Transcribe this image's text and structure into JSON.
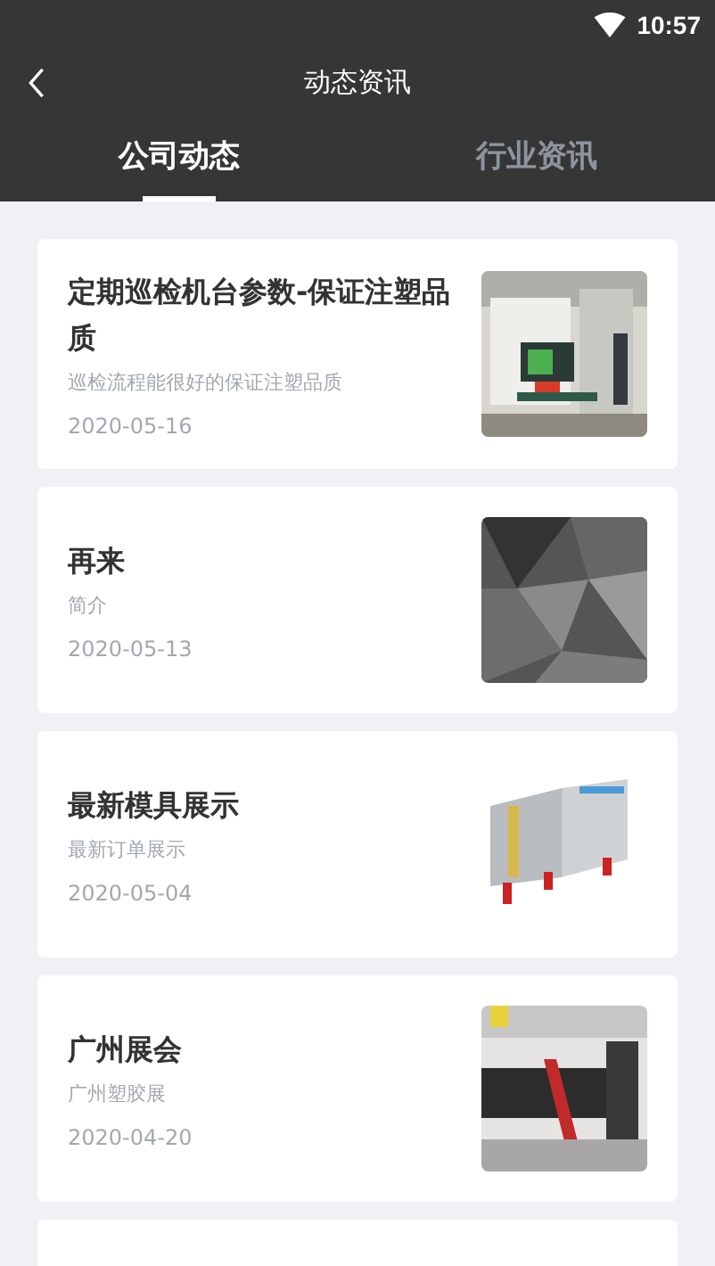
{
  "status_bar": {
    "time": "10:57"
  },
  "header": {
    "title": "动态资讯"
  },
  "tabs": [
    {
      "label": "公司动态",
      "selected": true
    },
    {
      "label": "行业资讯",
      "selected": false
    }
  ],
  "articles": [
    {
      "title": "定期巡检机台参数-保证注塑品质",
      "summary": "巡检流程能很好的保证注塑品质",
      "date": "2020-05-16"
    },
    {
      "title": "再来",
      "summary": "简介",
      "date": "2020-05-13"
    },
    {
      "title": "最新模具展示",
      "summary": "最新订单展示",
      "date": "2020-05-04"
    },
    {
      "title": "广州展会",
      "summary": "广州塑胶展",
      "date": "2020-04-20"
    }
  ]
}
